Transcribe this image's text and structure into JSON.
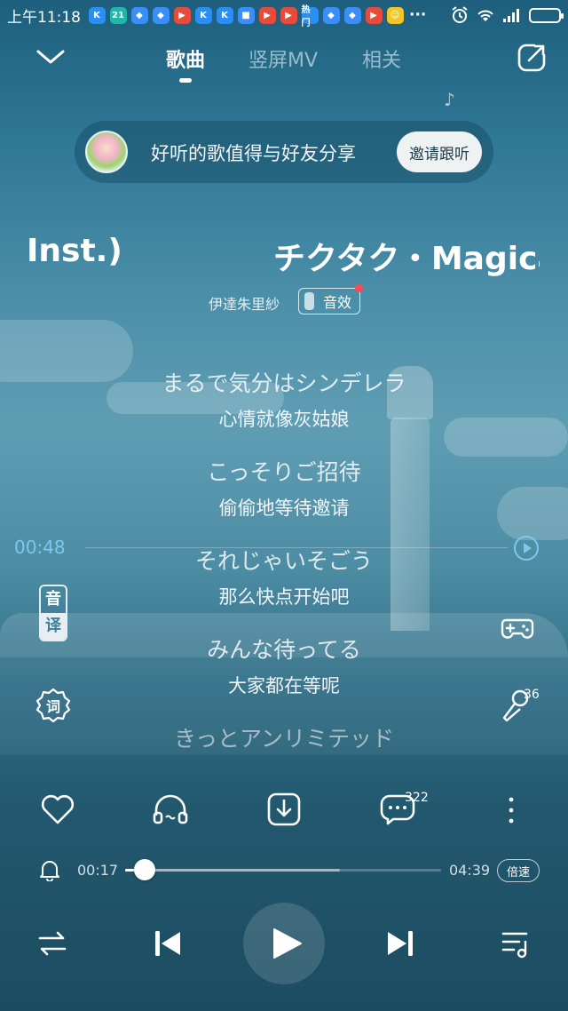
{
  "status_bar": {
    "time": "上午11:18",
    "app_icons": [
      {
        "name": "kuaiyin-icon",
        "color": "#2a8ff0",
        "glyph": "K"
      },
      {
        "name": "app-21-icon",
        "color": "#21b6a6",
        "glyph": "21"
      },
      {
        "name": "app-blue-icon",
        "color": "#3a8ef5",
        "glyph": "◆"
      },
      {
        "name": "app-blue2-icon",
        "color": "#3a8ef5",
        "glyph": "◆"
      },
      {
        "name": "video-play-icon",
        "color": "#e64c3c",
        "glyph": "▶"
      },
      {
        "name": "kuaiyin2-icon",
        "color": "#2a8ff0",
        "glyph": "K"
      },
      {
        "name": "kuaiyin3-icon",
        "color": "#2a8ff0",
        "glyph": "K"
      },
      {
        "name": "note-icon",
        "color": "#3a8ef5",
        "glyph": "■"
      },
      {
        "name": "video-play2-icon",
        "color": "#e64c3c",
        "glyph": "▶"
      },
      {
        "name": "video-play3-icon",
        "color": "#e64c3c",
        "glyph": "▶"
      },
      {
        "name": "hot-icon",
        "color": "#2a8ff0",
        "glyph": "热门"
      },
      {
        "name": "app-blue3-icon",
        "color": "#3a8ef5",
        "glyph": "◆"
      },
      {
        "name": "app-blue4-icon",
        "color": "#3a8ef5",
        "glyph": "◆"
      },
      {
        "name": "video-play4-icon",
        "color": "#e64c3c",
        "glyph": "▶"
      },
      {
        "name": "emoji-app-icon",
        "color": "#f3c623",
        "glyph": "☺"
      }
    ],
    "more": "···"
  },
  "header": {
    "tabs": [
      {
        "label": "歌曲",
        "active": true
      },
      {
        "label": "竖屏MV",
        "active": false
      },
      {
        "label": "相关",
        "active": false
      }
    ]
  },
  "share_banner": {
    "text": "好听的歌值得与好友分享",
    "button": "邀请跟听"
  },
  "song": {
    "title_scroll_left": "Inst.)",
    "title_scroll_right": "チクタク・Magical",
    "artist": "伊達朱里紗",
    "effect_label": "音效"
  },
  "lyrics": [
    {
      "jp": "まるで気分はシンデレラ",
      "cn": "心情就像灰姑娘"
    },
    {
      "jp": "こっそりご招待",
      "cn": "偷偷地等待邀请"
    },
    {
      "jp": "それじゃいそごう",
      "cn": "那么快点开始吧"
    },
    {
      "jp": "みんな待ってる",
      "cn": "大家都在等呢"
    },
    {
      "jp": "きっとアンリミテッド",
      "cn": ""
    }
  ],
  "seek_marker": {
    "time": "00:48"
  },
  "side": {
    "yinyi_top": "音",
    "yinyi_bottom": "译",
    "ci_label": "词",
    "mic_count": "36"
  },
  "actions": {
    "comment_count": "322"
  },
  "progress": {
    "current": "00:17",
    "total": "04:39",
    "fraction": 0.061,
    "buffered_fraction": 0.68,
    "speed_label": "倍速"
  },
  "colors": {
    "accent": "#7cc8ee"
  }
}
